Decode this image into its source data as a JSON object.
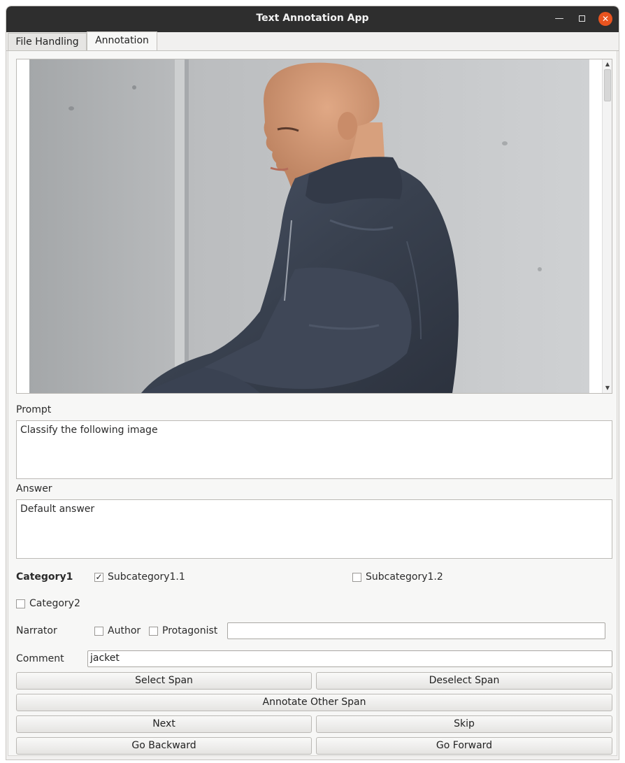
{
  "window": {
    "title": "Text Annotation App"
  },
  "tabs": [
    {
      "label": "File Handling"
    },
    {
      "label": "Annotation"
    }
  ],
  "prompt": {
    "label": "Prompt",
    "text": "Classify the following image"
  },
  "answer": {
    "label": "Answer",
    "text": "Default answer"
  },
  "category1": {
    "label": "Category1",
    "subcategories": [
      {
        "label": "Subcategory1.1",
        "checked": true
      },
      {
        "label": "Subcategory1.2",
        "checked": false
      }
    ]
  },
  "category2": {
    "label": "Category2",
    "checked": false
  },
  "narrator": {
    "label": "Narrator",
    "options": [
      {
        "label": "Author",
        "checked": false
      },
      {
        "label": "Protagonist",
        "checked": false
      }
    ],
    "value": ""
  },
  "comment": {
    "label": "Comment",
    "value": "jacket"
  },
  "buttons": {
    "select_span": "Select Span",
    "deselect_span": "Deselect Span",
    "annotate_other_span": "Annotate Other Span",
    "next": "Next",
    "skip": "Skip",
    "go_backward": "Go Backward",
    "go_forward": "Go Forward"
  },
  "colors": {
    "titlebar": "#2e2e2e",
    "close_button": "#e9541f",
    "jacket": "#3b4356",
    "skin": "#d09672"
  }
}
